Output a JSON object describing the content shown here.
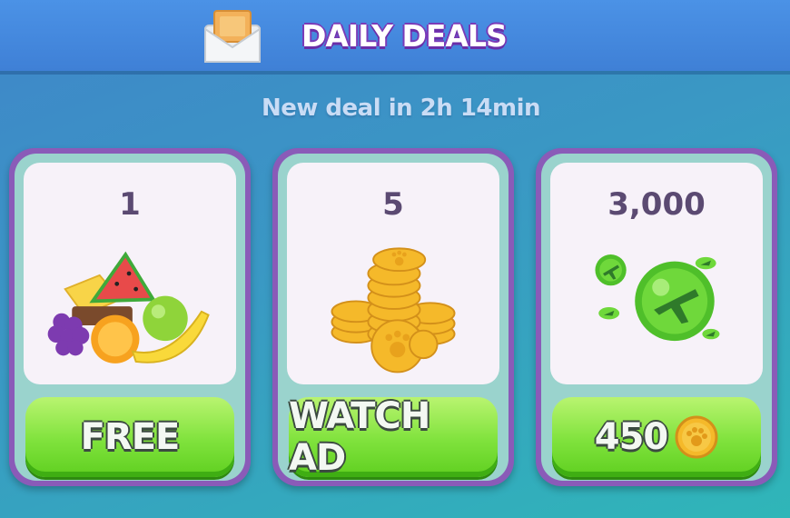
{
  "header": {
    "title": "DAILY DEALS",
    "icon": "envelope-icon"
  },
  "timer_text": "New deal in 2h 14min",
  "deals": [
    {
      "amount": "1",
      "item": "fruit-bundle-icon",
      "button_label": "FREE"
    },
    {
      "amount": "5",
      "item": "paw-coin-stack-icon",
      "button_label": "WATCH AD"
    },
    {
      "amount": "3,000",
      "item": "plane-bubbles-icon",
      "button_label": "450",
      "button_icon": "paw-coin-icon"
    }
  ],
  "colors": {
    "header_bg": "#3f80d6",
    "card_border": "#8a5bb8",
    "button_green": "#7fe23c",
    "amount_text": "#5b4a72"
  }
}
